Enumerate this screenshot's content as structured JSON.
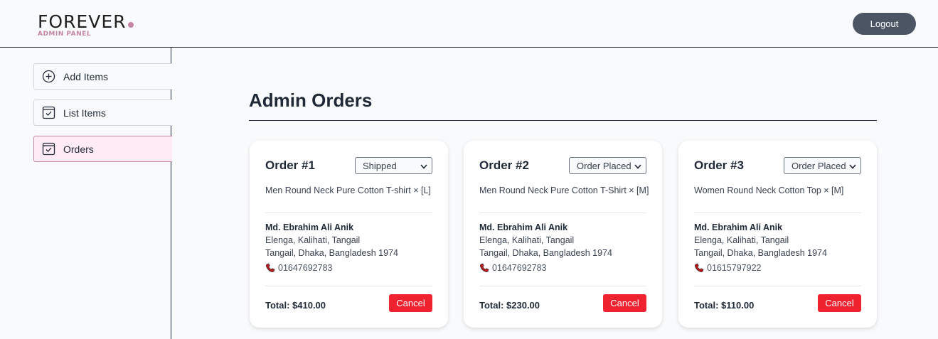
{
  "header": {
    "logo_text": "FOREVER",
    "logo_sub": "ADMIN PANEL",
    "logout_label": "Logout"
  },
  "sidebar": {
    "items": [
      {
        "label": "Add Items",
        "icon": "add-circle-icon"
      },
      {
        "label": "List Items",
        "icon": "checklist-icon"
      },
      {
        "label": "Orders",
        "icon": "orders-icon",
        "active": true
      }
    ]
  },
  "main": {
    "title": "Admin Orders"
  },
  "orders": [
    {
      "title": "Order #1",
      "status": "Shipped",
      "product": "Men Round Neck Pure Cotton T-shirt × [L]",
      "customer": "Md. Ebrahim Ali Anik",
      "address_line1": "Elenga, Kalihati, Tangail",
      "address_line2": "Tangail, Dhaka, Bangladesh 1974",
      "phone": "01647692783",
      "total": "Total: $410.00",
      "cancel_label": "Cancel"
    },
    {
      "title": "Order #2",
      "status": "Order Placed",
      "product": "Men Round Neck Pure Cotton T-Shirt × [M]",
      "customer": "Md. Ebrahim Ali Anik",
      "address_line1": "Elenga, Kalihati, Tangail",
      "address_line2": "Tangail, Dhaka, Bangladesh 1974",
      "phone": "01647692783",
      "total": "Total: $230.00",
      "cancel_label": "Cancel"
    },
    {
      "title": "Order #3",
      "status": "Order Placed",
      "product": "Women Round Neck Cotton Top × [M]",
      "customer": "Md. Ebrahim Ali Anik",
      "address_line1": "Elenga, Kalihati, Tangail",
      "address_line2": "Tangail, Dhaka, Bangladesh 1974",
      "phone": "01615797922",
      "total": "Total: $110.00",
      "cancel_label": "Cancel"
    }
  ],
  "colors": {
    "brand_accent": "#c586a5",
    "active_nav_bg": "#ffebf5",
    "cancel_red": "#ef2330",
    "logout_bg": "#4b5563"
  }
}
